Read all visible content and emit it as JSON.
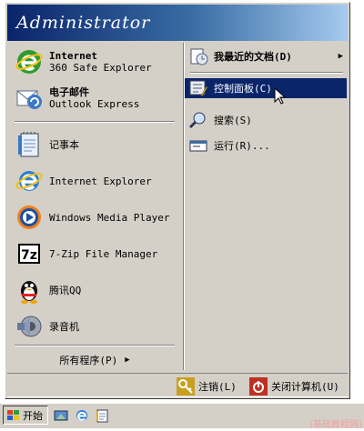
{
  "header": {
    "user_name": "Administrator"
  },
  "left_pinned": [
    {
      "title": "Internet",
      "subtitle": "360 Safe Explorer",
      "icon": "ie-360-icon"
    },
    {
      "title": "电子邮件",
      "subtitle": "Outlook Express",
      "icon": "outlook-express-icon"
    }
  ],
  "left_recent": [
    {
      "label": "记事本",
      "icon": "notepad-icon"
    },
    {
      "label": "Internet Explorer",
      "icon": "internet-explorer-icon"
    },
    {
      "label": "Windows Media Player",
      "icon": "media-player-icon"
    },
    {
      "label": "7-Zip File Manager",
      "icon": "7zip-icon"
    },
    {
      "label": "腾讯QQ",
      "icon": "qq-penguin-icon"
    },
    {
      "label": "录音机",
      "icon": "sound-recorder-icon"
    }
  ],
  "all_programs": {
    "label": "所有程序(P)"
  },
  "right_items": [
    {
      "label": "我最近的文档(D)",
      "icon": "recent-documents-icon",
      "bold": true,
      "submenu": true
    },
    {
      "label": "控制面板(C)",
      "icon": "control-panel-icon",
      "highlighted": true
    },
    {
      "label": "搜索(S)",
      "icon": "search-icon"
    },
    {
      "label": "运行(R)...",
      "icon": "run-icon"
    }
  ],
  "bottom": {
    "logoff_label": "注销(L)",
    "shutdown_label": "关闭计算机(U)"
  },
  "taskbar": {
    "start_label": "开始",
    "quick_launch": [
      "show-desktop-icon",
      "ie-360-quicklaunch-icon",
      "notepad-quicklaunch-icon"
    ]
  },
  "watermark": "(基础教程网)",
  "colors": {
    "menu_face": "#d4d0c8",
    "header_start": "#0a246a",
    "header_end": "#a6caf0",
    "highlight": "#0a246a"
  }
}
